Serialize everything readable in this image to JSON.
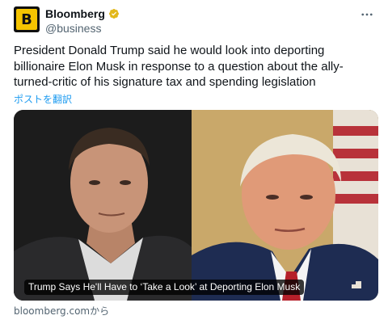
{
  "author": {
    "display_name": "Bloomberg",
    "handle": "@business",
    "avatar_letter": "B",
    "verified_icon": "verified-gold-badge-icon",
    "brand_color": "#f5c400"
  },
  "menu_icon": "more-horizontal-icon",
  "tweet": {
    "text": "President Donald Trump said he would look into deporting billionaire Elon Musk in response to a question about the ally-turned-critic of his signature tax and spending legislation",
    "translate_label": "ポストを翻訳"
  },
  "card": {
    "caption": "Trump Says He'll Have to ‘Take a Look’ at Deporting Elon Musk",
    "source": "bloomberg.comから"
  }
}
